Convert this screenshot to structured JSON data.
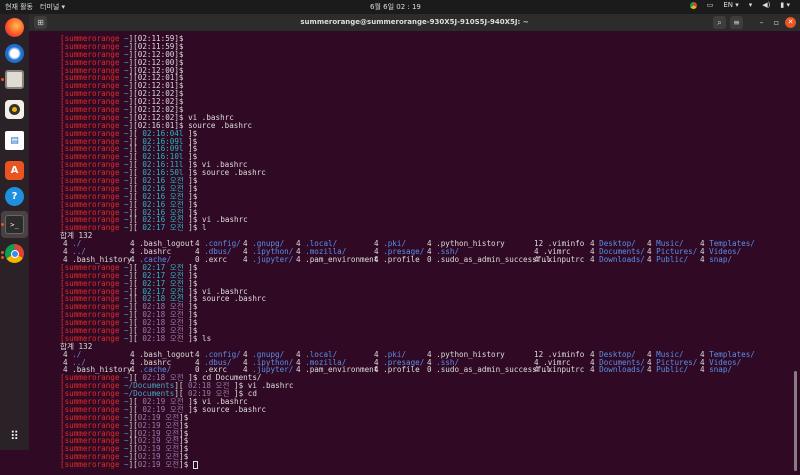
{
  "topbar": {
    "activities": "현재 활동",
    "app_menu": "터미널 ▾",
    "clock": "6월 6일 02 : 19",
    "lang": "EN ▾"
  },
  "window": {
    "title": "summerorange@summerorange-930X5J-910S5J-940X5J: ~"
  },
  "dock": [
    "firefox",
    "thunderbird",
    "files",
    "rhythmbox",
    "libreoffice-writer",
    "ubuntu-software",
    "help",
    "terminal",
    "chrome",
    "show-applications"
  ],
  "prompt": {
    "user": "summerorange"
  },
  "lines": [
    {
      "d": "~",
      "t": "02:11:59",
      "s": "w"
    },
    {
      "d": "~",
      "t": "02:11:59",
      "s": "w"
    },
    {
      "d": "~",
      "t": "02:12:00",
      "s": "w"
    },
    {
      "d": "~",
      "t": "02:12:00",
      "s": "w"
    },
    {
      "d": "~",
      "t": "02:12:00",
      "s": "w"
    },
    {
      "d": "~",
      "t": "02:12:01",
      "s": "w"
    },
    {
      "d": "~",
      "t": "02:12:01",
      "s": "w"
    },
    {
      "d": "~",
      "t": "02:12:02",
      "s": "w"
    },
    {
      "d": "~",
      "t": "02:12:02",
      "s": "w"
    },
    {
      "d": "~",
      "t": "02:12:02",
      "s": "w"
    },
    {
      "d": "~",
      "t": "02:12:02",
      "s": "w",
      "cmd": "vi .bashrc"
    },
    {
      "d": "~",
      "t": "02:16:01",
      "s": "w",
      "cmd": "source .bashrc"
    },
    {
      "d": "~",
      "t": "02:16:04l",
      "s": "c"
    },
    {
      "d": "~",
      "t": "02:16:09l",
      "s": "c"
    },
    {
      "d": "~",
      "t": "02:16:09l",
      "s": "c"
    },
    {
      "d": "~",
      "t": "02:16:10l",
      "s": "c"
    },
    {
      "d": "~",
      "t": "02:16:11l",
      "s": "c",
      "cmd": "vi .bashrc"
    },
    {
      "d": "~",
      "t": "02:16:50l",
      "s": "c",
      "cmd": "source .bashrc"
    },
    {
      "d": "~",
      "t": "02:16 오전",
      "s": "c"
    },
    {
      "d": "~",
      "t": "02:16 오전",
      "s": "c"
    },
    {
      "d": "~",
      "t": "02:16 오전",
      "s": "c"
    },
    {
      "d": "~",
      "t": "02:16 오전",
      "s": "c"
    },
    {
      "d": "~",
      "t": "02:16 오전",
      "s": "c"
    },
    {
      "d": "~",
      "t": "02:16 오전",
      "s": "c",
      "cmd": "vi .bashrc"
    },
    {
      "d": "~",
      "t": "02:17 오전",
      "s": "c",
      "cmd": "l"
    },
    {
      "total": "합계 132"
    },
    {
      "ls": 0
    },
    {
      "ls": 1
    },
    {
      "ls": 2
    },
    {
      "d": "~",
      "t": "02:17 오전",
      "s": "c"
    },
    {
      "d": "~",
      "t": "02:17 오전",
      "s": "c"
    },
    {
      "d": "~",
      "t": "02:17 오전",
      "s": "c"
    },
    {
      "d": "~",
      "t": "02:17 오전",
      "s": "c",
      "cmd": "vi .bashrc"
    },
    {
      "d": "~",
      "t": "02:18 오전",
      "s": "c",
      "cmd": "source .bashrc"
    },
    {
      "d": "~",
      "t": "02:18 오전",
      "s": "p"
    },
    {
      "d": "~",
      "t": "02:18 오전",
      "s": "p"
    },
    {
      "d": "~",
      "t": "02:18 오전",
      "s": "p"
    },
    {
      "d": "~",
      "t": "02:18 오전",
      "s": "p"
    },
    {
      "d": "~",
      "t": "02:18 오전",
      "s": "p",
      "cmd": "ls"
    },
    {
      "total": "합계 132"
    },
    {
      "ls": 0
    },
    {
      "ls": 1
    },
    {
      "ls": 2
    },
    {
      "d": "~",
      "t": "02:18 오전",
      "s": "p",
      "cmd": "cd Documents/"
    },
    {
      "d": "~/Documents",
      "t": "02:18 오전",
      "s": "p",
      "cmd": "vi .bashrc"
    },
    {
      "d": "~/Documents",
      "t": "02:19 오전",
      "s": "p",
      "cmd": "cd"
    },
    {
      "d": "~",
      "t": "02:19 오전",
      "s": "p",
      "cmd": "vi .bashrc"
    },
    {
      "d": "~",
      "t": "02:19 오전",
      "s": "p",
      "cmd": "source .bashrc"
    },
    {
      "d": "~",
      "t": "02:19 오전",
      "s": "p",
      "tight": true
    },
    {
      "d": "~",
      "t": "02:19 오전",
      "s": "p",
      "tight": true
    },
    {
      "d": "~",
      "t": "02:19 오전",
      "s": "p",
      "tight": true
    },
    {
      "d": "~",
      "t": "02:19 오전",
      "s": "p",
      "tight": true
    },
    {
      "d": "~",
      "t": "02:19 오전",
      "s": "p",
      "tight": true
    },
    {
      "d": "~",
      "t": "02:19 오전",
      "s": "p",
      "tight": true
    },
    {
      "d": "~",
      "t": "02:19 오전",
      "s": "p",
      "tight": true,
      "cursor": true
    }
  ],
  "ls_rows": [
    [
      [
        "4",
        "./",
        1
      ],
      [
        "4",
        ".bash_logout",
        0
      ],
      [
        "4",
        ".config/",
        1
      ],
      [
        "4",
        ".gnupg/",
        1
      ],
      [
        "4",
        ".local/",
        1
      ],
      [
        "4",
        ".pki/",
        1
      ],
      [
        "4",
        ".python_history",
        0
      ],
      [
        "12",
        ".viminfo",
        0
      ],
      [
        "4",
        "Desktop/",
        1
      ],
      [
        "4",
        "Music/",
        1
      ],
      [
        "4",
        "Templates/",
        1
      ]
    ],
    [
      [
        "4",
        "../",
        1
      ],
      [
        "4",
        ".bashrc",
        0
      ],
      [
        "4",
        ".dbus/",
        1
      ],
      [
        "4",
        ".ipython/",
        1
      ],
      [
        "4",
        ".mozilla/",
        1
      ],
      [
        "4",
        ".presage/",
        1
      ],
      [
        "4",
        ".ssh/",
        1
      ],
      [
        "4",
        ".vimrc",
        0
      ],
      [
        "4",
        "Documents/",
        1
      ],
      [
        "4",
        "Pictures/",
        1
      ],
      [
        "4",
        "Videos/",
        1
      ]
    ],
    [
      [
        "4",
        ".bash_history",
        0
      ],
      [
        "4",
        ".cache/",
        1
      ],
      [
        "0",
        ".exrc",
        0
      ],
      [
        "4",
        ".jupyter/",
        1
      ],
      [
        "4",
        ".pam_environment",
        0
      ],
      [
        "4",
        ".profile",
        0
      ],
      [
        "0",
        ".sudo_as_admin_successful",
        0
      ],
      [
        "4",
        ".xinputrc",
        0
      ],
      [
        "4",
        "Downloads/",
        1
      ],
      [
        "4",
        "Public/",
        1
      ],
      [
        "4",
        "snap/",
        1
      ]
    ]
  ]
}
